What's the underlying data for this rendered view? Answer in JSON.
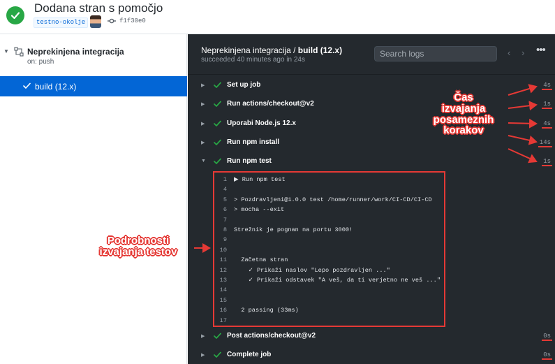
{
  "header": {
    "title": "Dodana stran s pomočjo",
    "environment": "testno-okolje",
    "commit_sha": "f1f30e0"
  },
  "sidebar": {
    "workflow_name": "Neprekinjena integracija",
    "trigger": "on: push",
    "job_label": "build (12.x)"
  },
  "panel": {
    "title_prefix": "Neprekinjena integracija / ",
    "title_job": "build (12.x)",
    "subtitle": "succeeded 40 minutes ago in 24s",
    "search_placeholder": "Search logs",
    "prev_glyph": "‹",
    "next_glyph": "›",
    "more_glyph": "•••"
  },
  "steps": [
    {
      "name": "Set up job",
      "duration": "4s",
      "expanded": false
    },
    {
      "name": "Run actions/checkout@v2",
      "duration": "1s",
      "expanded": false
    },
    {
      "name": "Uporabi Node.js 12.x",
      "duration": "4s",
      "expanded": false
    },
    {
      "name": "Run npm install",
      "duration": "14s",
      "expanded": false
    },
    {
      "name": "Run npm test",
      "duration": "1s",
      "expanded": true
    },
    {
      "name": "Post actions/checkout@v2",
      "duration": "0s",
      "expanded": false
    },
    {
      "name": "Complete job",
      "duration": "0s",
      "expanded": false
    }
  ],
  "log_lines": [
    {
      "num": "1",
      "text": "▶ Run npm test"
    },
    {
      "num": "4",
      "text": ""
    },
    {
      "num": "5",
      "text": "> Pozdravljeni@1.0.0 test /home/runner/work/CI-CD/CI-CD"
    },
    {
      "num": "6",
      "text": "> mocha --exit"
    },
    {
      "num": "7",
      "text": ""
    },
    {
      "num": "8",
      "text": "Strežnik je pognan na portu 3000!"
    },
    {
      "num": "9",
      "text": ""
    },
    {
      "num": "10",
      "text": ""
    },
    {
      "num": "11",
      "text": "  Začetna stran"
    },
    {
      "num": "12",
      "text": "    ✓ Prikaži naslov \"Lepo pozdravljen ...\""
    },
    {
      "num": "13",
      "text": "    ✓ Prikaži odstavek \"A veš, da ti verjetno ne veš ...\""
    },
    {
      "num": "14",
      "text": ""
    },
    {
      "num": "15",
      "text": ""
    },
    {
      "num": "16",
      "text": "  2 passing (33ms)"
    },
    {
      "num": "17",
      "text": ""
    }
  ],
  "annotations": {
    "step_times": [
      "Čas",
      "izvajanja",
      "posameznih",
      "korakov"
    ],
    "test_details": [
      "Podrobnosti",
      "izvajanja testov"
    ]
  },
  "colors": {
    "success_green": "#28a745",
    "selected_blue": "#0366d6",
    "log_bg": "#24292e",
    "annotation_red": "#e53935"
  },
  "icons": {
    "status": "check-circle-icon",
    "commit": "git-commit-icon",
    "workflow": "workflow-icon",
    "step_status": "check-icon"
  }
}
